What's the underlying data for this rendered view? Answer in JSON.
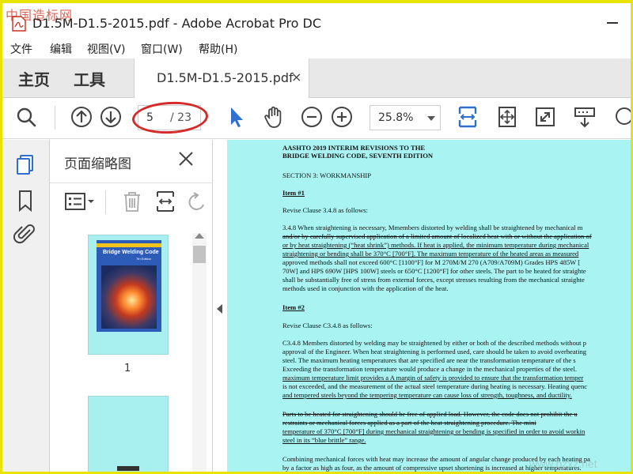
{
  "window": {
    "watermark": "中国造标网",
    "title": "D1.5M-D1.5-2015.pdf - Adobe Acrobat Pro DC"
  },
  "menu": [
    "文件",
    "编辑",
    "视图(V)",
    "窗口(W)",
    "帮助(H)"
  ],
  "tabs": {
    "home": "主页",
    "tools": "工具",
    "doc_tab": "D1.5M-D1.5-2015.pdf",
    "close": "×"
  },
  "toolbar": {
    "current_page": "5",
    "total_pages": "/ 23",
    "zoom": "25.8%"
  },
  "thumb_panel": {
    "title": "页面缩略图",
    "page1_number": "1",
    "cover_title": "Bridge Welding Code",
    "cover_edition": "7th Edition"
  },
  "document": {
    "lines": [
      "AASHTO 2019 INTERIM REVISIONS TO THE",
      "BRIDGE WELDING CODE, SEVENTH EDITION",
      "SECTION 3: WORKMANSHIP",
      "Item #1",
      "Revise Clause 3.4.8 as follows:",
      "3.4.8 When straightening is necessary, Mmembers distorted by welding shall be straightened by mechanical m",
      "and/or by carefully supervised application of a limited amount of localized heat with or without the application of",
      "or by heat straightening (“heat shrink”) methods. If heat is applied, the minimum temperature during mechanical",
      "straightening or bending shall be 370°C [700°F]. The maximum temperature of the heated areas as measured",
      "approved methods shall not exceed 600°C [1100°F] for M 270M/M 270 (A709/A709M) Grades HPS 485W [",
      "70W] and HPS 690W [HPS 100W] steels or 650°C [1200°F] for other steels. The part to be heated for straighte",
      "shall be substantially free of stress from external forces, except stresses resulting from the mechanical straighte",
      "methods used in conjunction with the application of the heat.",
      "Item #2",
      "Revise Clause C3.4.8 as follows:",
      "C3.4.8 Members distorted by welding may be straightened by either or both of the described methods without p",
      "approval of the Engineer. When heat straightening is performed used, care should be taken to avoid overheating",
      "steel. The maximum heating temperatures that are specified are near the transformation temperature of the s",
      "Exceeding the transformation temperature would produce a change in the mechanical properties of the steel.",
      "maximum temperature limit provides a A margin of safety is provided to ensure that the transformation temper",
      "is not exceeded, and the measurement of the actual steel temperature during heating is necessary. Heating quenc",
      "and tempered steels beyond the tempering temperature can cause loss of strength, toughness, and ductility.",
      "Parts to be heated for straightening should be free of applied load. However, the code does not prohibit the u",
      "restraints or mechanical forces applied as a part of the heat straightening procedure. The mini",
      "temperature of 370°C [700°F] during mechanical straightening or bending is specified in order to avoid workin",
      "steel in its “blue brittle” range.",
      "Combining mechanical forces with heat may increase the amount of angular change produced by each heating pa",
      "by a factor as high as four, as the amount of compressive upset shortening is increased at higher temperatures."
    ],
    "watermark": "www.bzxz.net"
  }
}
